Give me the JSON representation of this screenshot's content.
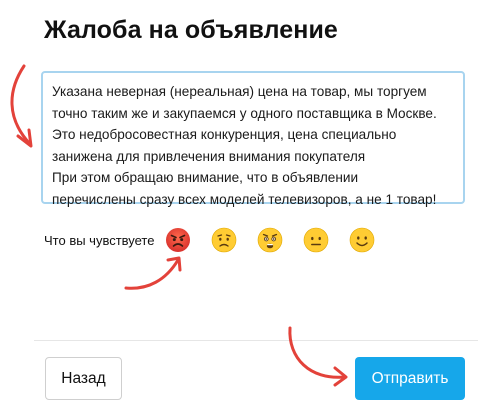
{
  "page": {
    "title": "Жалоба на объявление"
  },
  "complaint": {
    "lines": [
      "Указана неверная (нереальная) цена на товар, мы торгуем",
      "точно таким же и закупаемся у одного поставщика в Москве.",
      "Это недобросовестная конкуренция, цена специально",
      "занижена для привлечения внимания покупателя",
      "При этом обращаю внимание, что в объявлении",
      "перечислены сразу всех моделей телевизоров, а не 1 товар!"
    ]
  },
  "feelings": {
    "label": "Что вы чувствуете",
    "options": [
      {
        "icon": "angry-face-icon",
        "selected": true
      },
      {
        "icon": "sad-face-icon",
        "selected": false
      },
      {
        "icon": "anguished-face-icon",
        "selected": false
      },
      {
        "icon": "neutral-face-icon",
        "selected": false
      },
      {
        "icon": "smiling-face-icon",
        "selected": false
      }
    ]
  },
  "actions": {
    "back_label": "Назад",
    "submit_label": "Отправить"
  },
  "colors": {
    "accent": "#16a7ea",
    "textarea_border": "#a8d4ef",
    "annotation_arrow": "#e3423a",
    "angry_face": "#e8403a",
    "emoji_yellow": "#ffcc33"
  }
}
